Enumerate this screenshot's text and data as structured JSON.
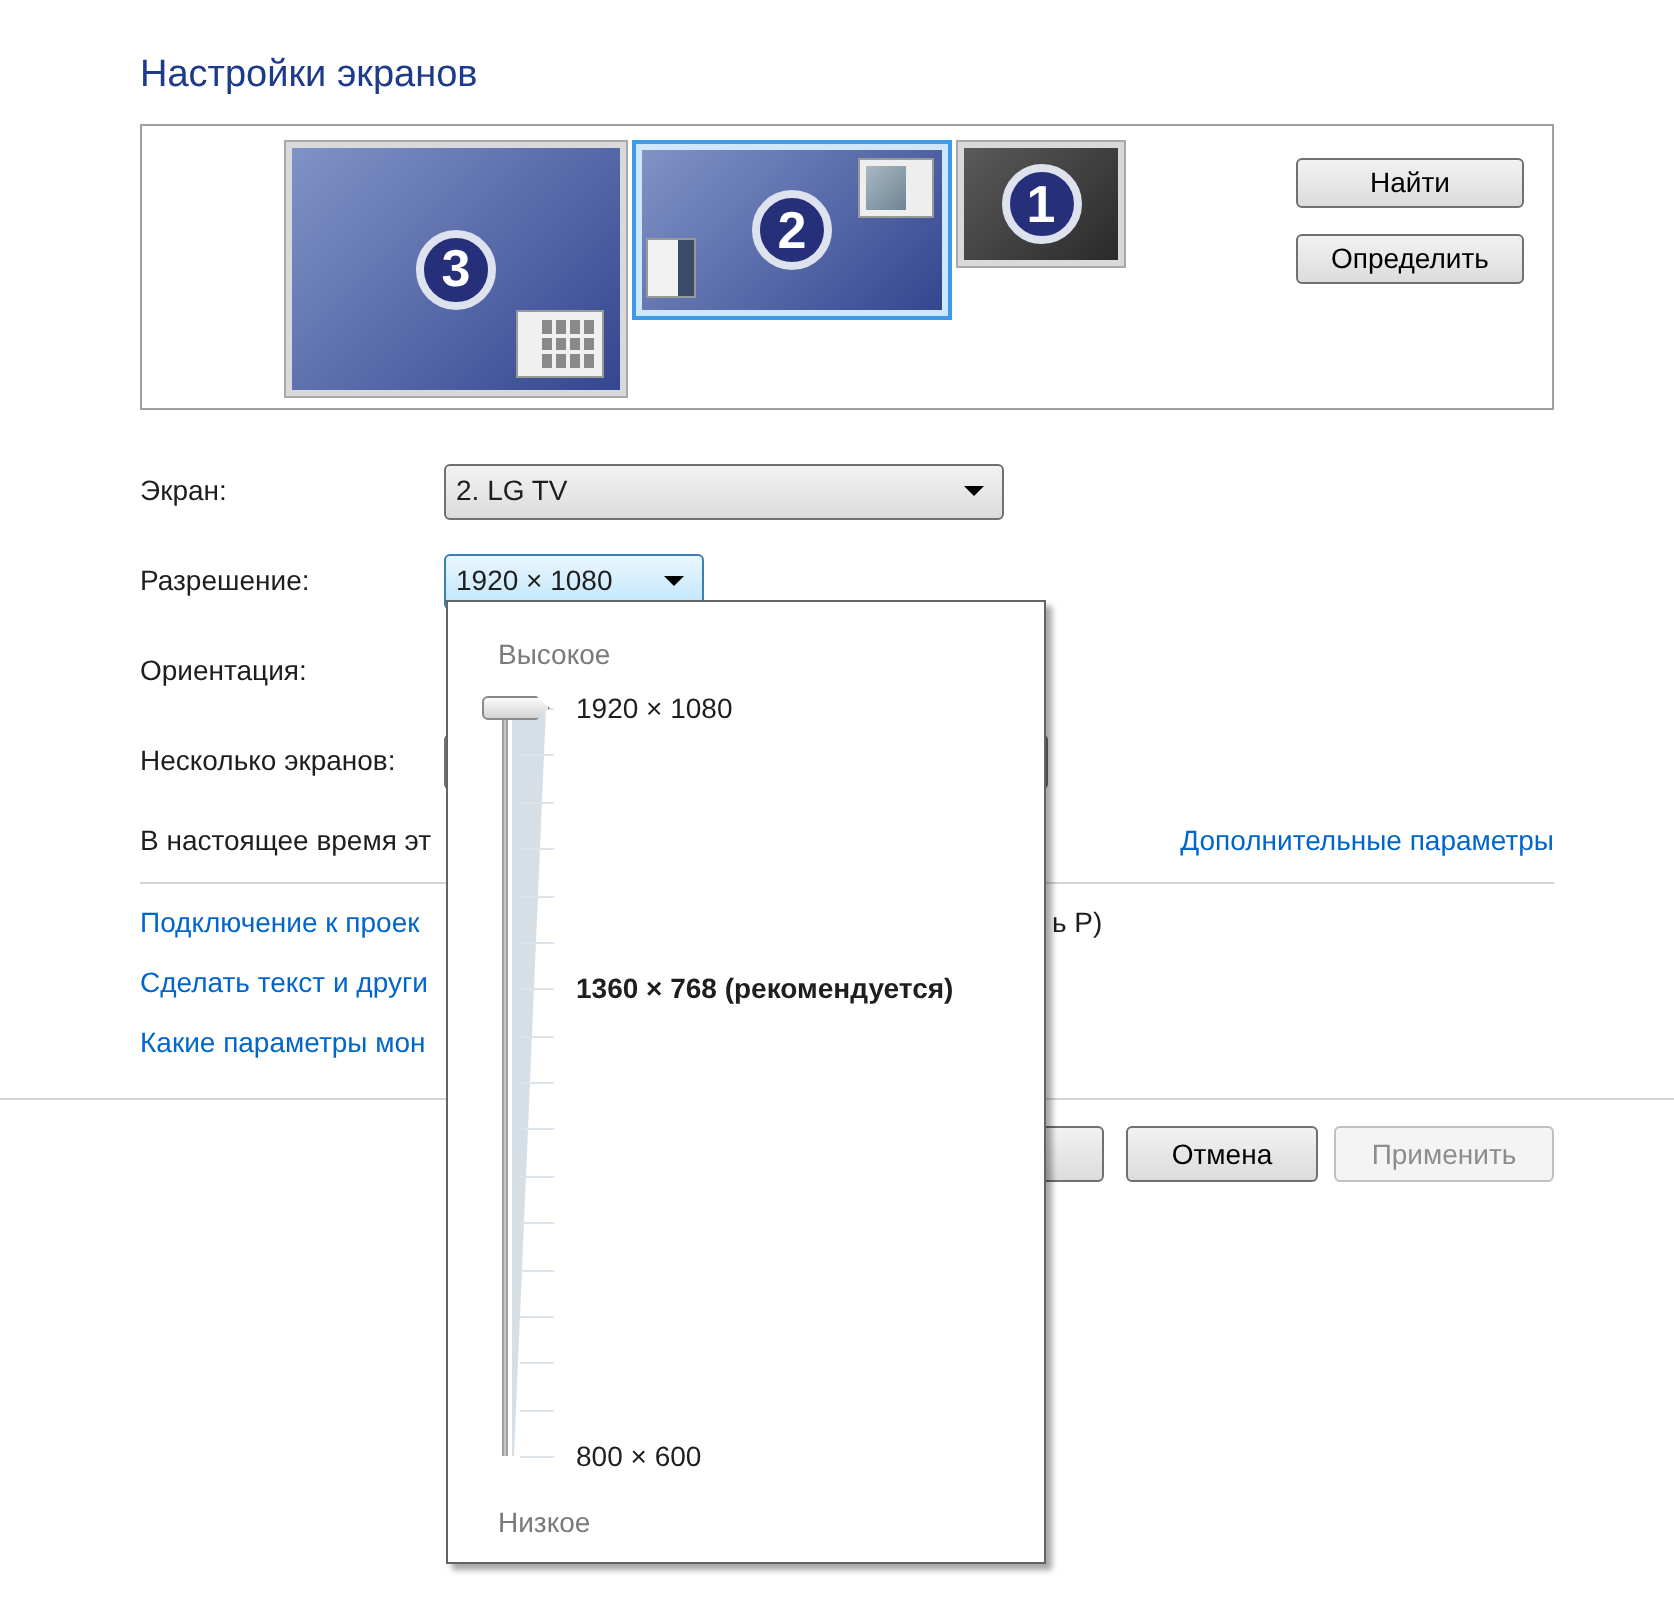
{
  "title": "Настройки экранов",
  "monitors": [
    {
      "number": "3",
      "selected": false,
      "active": true
    },
    {
      "number": "2",
      "selected": true,
      "active": true
    },
    {
      "number": "1",
      "selected": false,
      "active": false
    }
  ],
  "side_buttons": [
    "Найти",
    "Определить"
  ],
  "fields": [
    {
      "kind": "dropdown",
      "label": "Экран:",
      "value": "2. LG TV",
      "focused": false
    },
    {
      "kind": "dropdown",
      "label": "Разрешение:",
      "value": "1920 × 1080",
      "focused": true
    },
    {
      "kind": "hidden",
      "label": "Ориентация:"
    },
    {
      "kind": "covered",
      "label": "Несколько экранов:"
    }
  ],
  "status_text": "В настоящее время эт",
  "advanced_link": "Дополнительные параметры",
  "links": [
    {
      "text": "Подключение к проек",
      "tail": "ь P)"
    },
    {
      "text": "Сделать текст и други"
    },
    {
      "text": "Какие параметры мон"
    }
  ],
  "buttons": [
    {
      "kind": "covered"
    },
    {
      "kind": "normal",
      "label": "Отмена",
      "disabled": false
    },
    {
      "kind": "normal",
      "label": "Применить",
      "disabled": true
    }
  ],
  "resolution_popup": {
    "high_label": "Высокое",
    "low_label": "Низкое",
    "level": 1,
    "ticks": [
      {
        "kind": "label",
        "label": "1920 × 1080"
      },
      {
        "kind": "plain"
      },
      {
        "kind": "plain"
      },
      {
        "kind": "plain"
      },
      {
        "kind": "plain"
      },
      {
        "kind": "plain"
      },
      {
        "kind": "recommended",
        "label": "1360 × 768 (рекомендуется)"
      },
      {
        "kind": "plain"
      },
      {
        "kind": "plain"
      },
      {
        "kind": "plain"
      },
      {
        "kind": "plain"
      },
      {
        "kind": "plain"
      },
      {
        "kind": "plain"
      },
      {
        "kind": "plain"
      },
      {
        "kind": "plain"
      },
      {
        "kind": "plain"
      },
      {
        "kind": "label",
        "label": "800 × 600"
      }
    ]
  }
}
